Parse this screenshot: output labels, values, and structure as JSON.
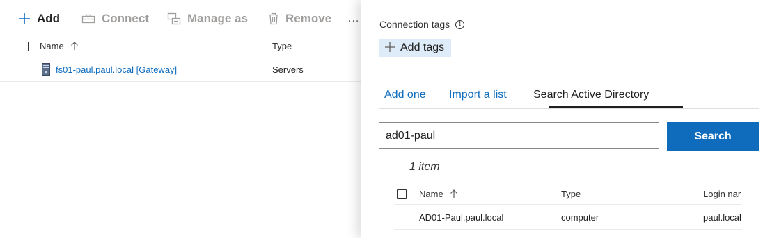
{
  "toolbar": {
    "add_label": "Add",
    "connect_label": "Connect",
    "manage_as_label": "Manage as",
    "remove_label": "Remove",
    "more_label": "..."
  },
  "connections_list": {
    "columns": {
      "name": "Name",
      "type": "Type"
    },
    "rows": [
      {
        "name": "fs01-paul.paul.local [Gateway]",
        "type": "Servers"
      }
    ]
  },
  "panel": {
    "connection_tags_label": "Connection tags",
    "info_glyph": "i",
    "add_tags_label": "Add tags",
    "tabs": [
      {
        "label": "Add one"
      },
      {
        "label": "Import a list"
      },
      {
        "label": "Search Active Directory"
      }
    ],
    "active_tab": "Search Active Directory",
    "search": {
      "value": "ad01-paul",
      "button_label": "Search"
    },
    "result_count": "1 item",
    "results": {
      "columns": {
        "name": "Name",
        "type": "Type",
        "login": "Login nar"
      },
      "rows": [
        {
          "name": "AD01-Paul.paul.local",
          "type": "computer",
          "login": "paul.local"
        }
      ]
    }
  },
  "colors": {
    "accent": "#0f6cbd",
    "tag_bg": "#deecf9",
    "disabled": "#a19f9d"
  }
}
